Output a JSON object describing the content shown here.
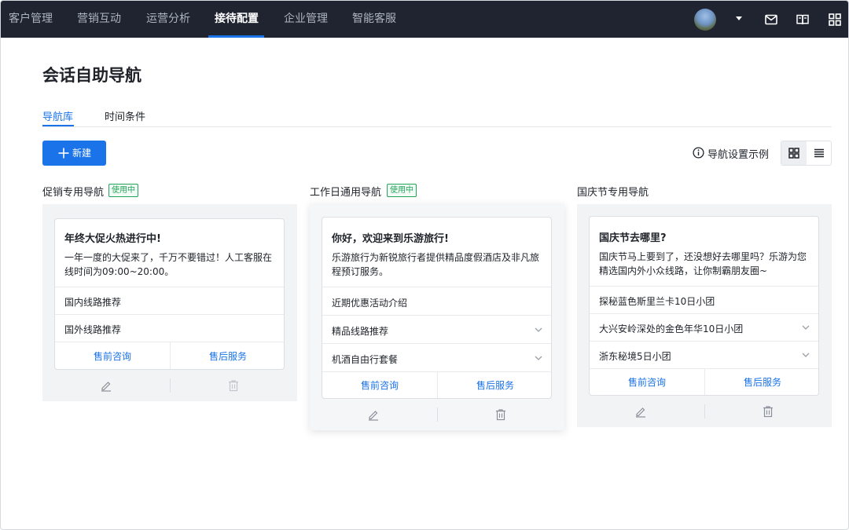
{
  "nav": {
    "items": [
      "客户管理",
      "营销互动",
      "运营分析",
      "接待配置",
      "企业管理",
      "智能客服"
    ],
    "active_index": 3
  },
  "header": {
    "title": "会话自助导航",
    "tabs": [
      "导航库",
      "时间条件"
    ],
    "new_button": "新建",
    "example_link": "导航设置示例"
  },
  "columns": [
    {
      "title": "促销专用导航",
      "badge": "使用中",
      "card": {
        "head": "年终大促火热进行中!",
        "desc": "一年一度的大促来了，千万不要错过！人工客服在线时间为09:00~20:00。",
        "rows": [
          "国内线路推荐",
          "国外线路推荐"
        ],
        "buttons": [
          "售前咨询",
          "售后服务"
        ]
      }
    },
    {
      "title": "工作日通用导航",
      "badge": "使用中",
      "card": {
        "head": "你好，欢迎来到乐游旅行!",
        "desc": "乐游旅行为新锐旅行者提供精品度假酒店及非凡旅程预订服务。",
        "rows": [
          "近期优惠活动介绍",
          "精品线路推荐",
          "机酒自由行套餐"
        ],
        "buttons": [
          "售前咨询",
          "售后服务"
        ]
      }
    },
    {
      "title": "国庆节专用导航",
      "badge": "",
      "card": {
        "head": "国庆节去哪里?",
        "desc": "国庆节马上要到了，还没想好去哪里吗？乐游为您精选国内外小众线路，让你制霸朋友圈~",
        "rows": [
          "探秘蓝色斯里兰卡10日小团",
          "大兴安岭深处的金色年华10日小团",
          "浙东秘境5日小团"
        ],
        "buttons": [
          "售前咨询",
          "售后服务"
        ]
      }
    }
  ],
  "colors": {
    "nav_bg": "#1f2430",
    "accent": "#1a73e8",
    "badge_green": "#22a559",
    "panel_bg": "#f2f3f5"
  },
  "icons": [
    "avatar",
    "chevron-down-icon",
    "mail-icon",
    "book-icon",
    "apps-icon",
    "plus-icon",
    "info-icon",
    "grid-view-icon",
    "list-view-icon",
    "edit-icon",
    "trash-icon"
  ]
}
